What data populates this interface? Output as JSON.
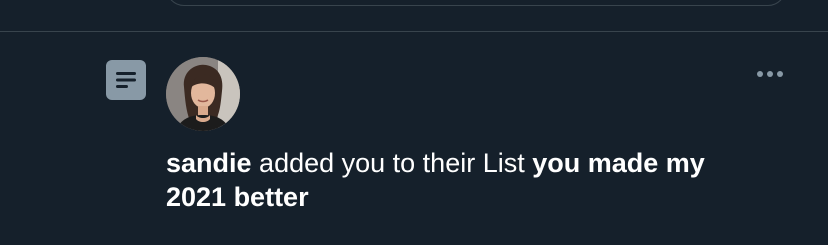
{
  "colors": {
    "background": "#15202b",
    "divider": "#38444d",
    "icon_gray": "#8899a6",
    "text": "#ffffff"
  },
  "icons": {
    "list": "list-icon",
    "more": "more-icon"
  },
  "notification": {
    "user_name": "sandie",
    "action_text": " added you to their List ",
    "list_name": "you made my 2021 better"
  }
}
